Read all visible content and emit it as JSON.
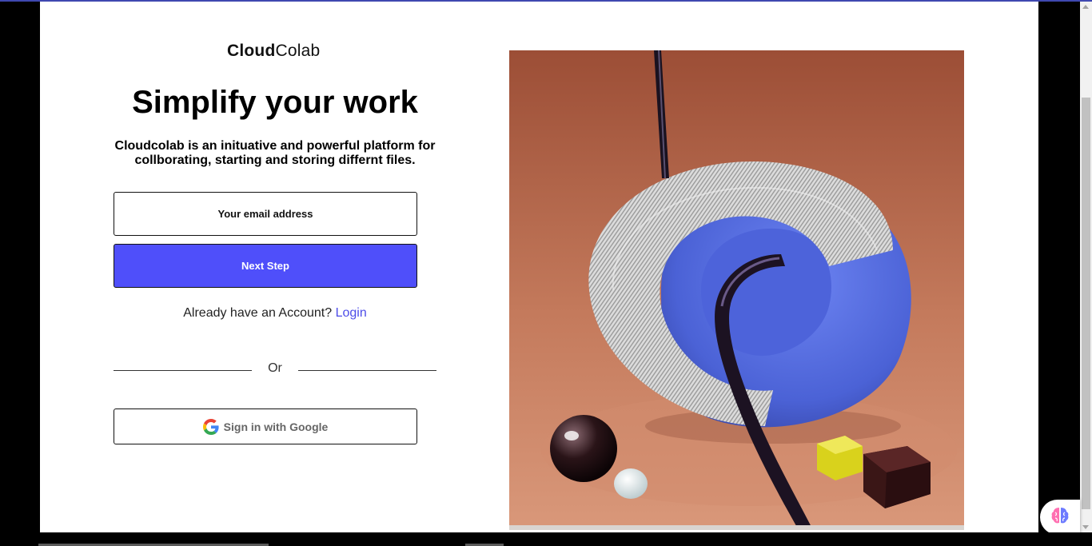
{
  "brand": {
    "bold": "Cloud",
    "light": "Colab"
  },
  "hero": {
    "headline": "Simplify your work",
    "subtitle": "Cloudcolab is an inituative and powerful platform for collborating, starting and storing differnt files."
  },
  "form": {
    "email_placeholder": "Your email address",
    "next_label": "Next Step",
    "account_prompt": "Already have an Account?",
    "login_link": "Login",
    "or_label": "Or",
    "google_label": "Sign in with Google"
  },
  "icons": {
    "google": "google-g-icon",
    "assistant": "brain-icon"
  },
  "colors": {
    "accent": "#4f4ffa",
    "link": "#4d4de8",
    "hero_bg": "#b86a4e"
  }
}
